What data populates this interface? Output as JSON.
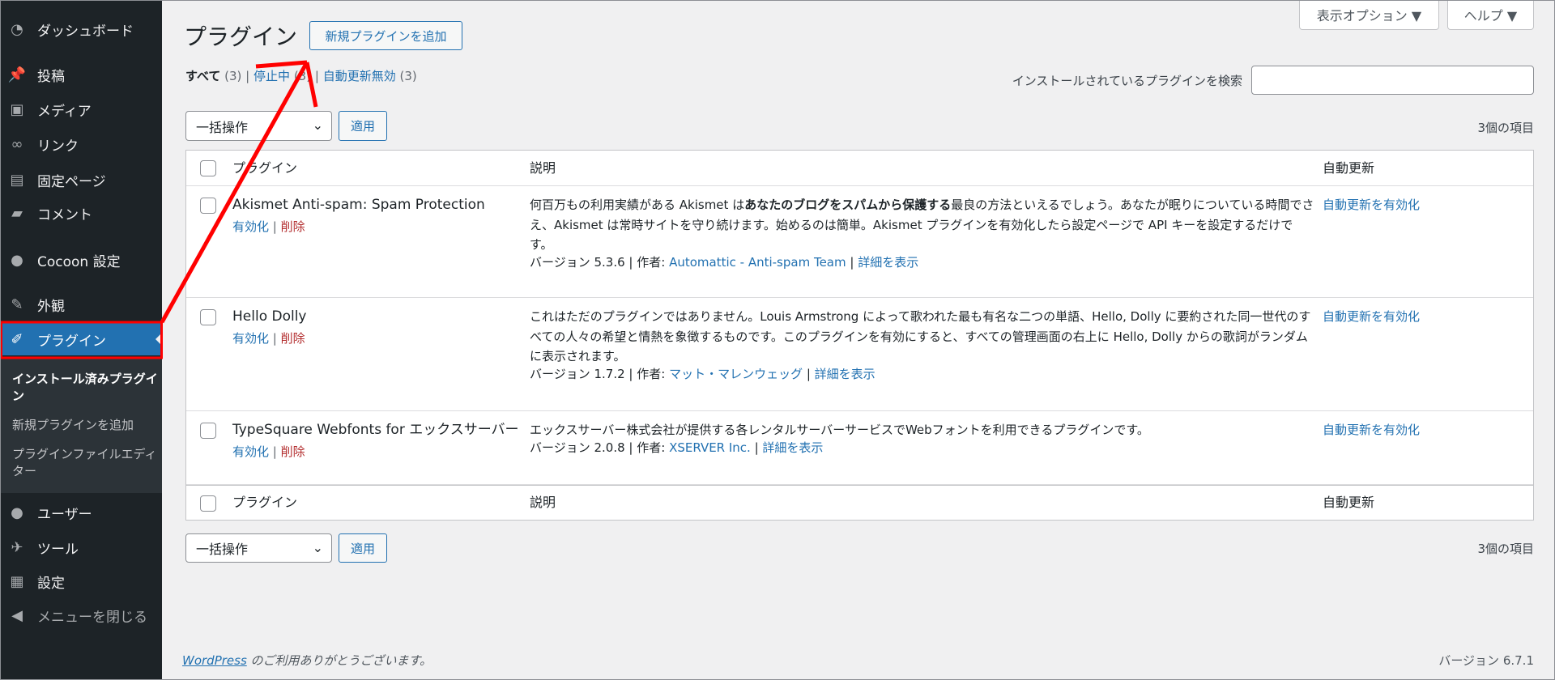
{
  "sidebar": {
    "items": [
      {
        "label": "ダッシュボード",
        "icon": "dashboard-icon"
      },
      {
        "label": "投稿",
        "icon": "pin-icon"
      },
      {
        "label": "メディア",
        "icon": "media-icon"
      },
      {
        "label": "リンク",
        "icon": "link-icon"
      },
      {
        "label": "固定ページ",
        "icon": "page-icon"
      },
      {
        "label": "コメント",
        "icon": "comment-icon"
      },
      {
        "label": "Cocoon 設定",
        "icon": "circle-icon"
      },
      {
        "label": "外観",
        "icon": "brush-icon"
      },
      {
        "label": "プラグイン",
        "icon": "plugin-icon"
      },
      {
        "label": "ユーザー",
        "icon": "user-icon"
      },
      {
        "label": "ツール",
        "icon": "wrench-icon"
      },
      {
        "label": "設定",
        "icon": "settings-icon"
      },
      {
        "label": "メニューを閉じる",
        "icon": "collapse-icon"
      }
    ],
    "submenu": [
      "インストール済みプラグイン",
      "新規プラグインを追加",
      "プラグインファイルエディター"
    ]
  },
  "header": {
    "title": "プラグイン",
    "add_new": "新規プラグインを追加",
    "screen_options": "表示オプション ▼",
    "help": "ヘルプ ▼"
  },
  "filters": [
    {
      "label": "すべて",
      "count": "(3)"
    },
    {
      "label": "停止中",
      "count": "(3)"
    },
    {
      "label": "自動更新無効",
      "count": "(3)"
    }
  ],
  "search": {
    "label": "インストールされているプラグインを検索",
    "value": ""
  },
  "bulk": {
    "select": "一括操作",
    "apply": "適用",
    "count": "3個の項目"
  },
  "table": {
    "columns": [
      "プラグイン",
      "説明",
      "自動更新"
    ],
    "rows": [
      {
        "name": "Akismet Anti-spam: Spam Protection",
        "activate": "有効化",
        "delete": "削除",
        "desc_pre": "何百万もの利用実績がある Akismet は",
        "desc_bold": "あなたのブログをスパムから保護する",
        "desc_post": "最良の方法といえるでしょう。あなたが眠りについている時間でさえ、Akismet は常時サイトを守り続けます。始めるのは簡単。Akismet プラグインを有効化したら設定ページで API キーを設定するだけです。",
        "version": "バージョン 5.3.6 | 作者: ",
        "author": "Automattic - Anti-spam Team",
        "details": "詳細を表示",
        "auto": "自動更新を有効化"
      },
      {
        "name": "Hello Dolly",
        "activate": "有効化",
        "delete": "削除",
        "desc_pre": "これはただのプラグインではありません。Louis Armstrong によって歌われた最も有名な二つの単語、Hello, Dolly に要約された同一世代のすべての人々の希望と情熱を象徴するものです。このプラグインを有効にすると、すべての管理画面の右上に Hello, Dolly からの歌詞がランダムに表示されます。",
        "desc_bold": "",
        "desc_post": "",
        "version": "バージョン 1.7.2 | 作者: ",
        "author": "マット・マレンウェッグ",
        "details": "詳細を表示",
        "auto": "自動更新を有効化"
      },
      {
        "name": "TypeSquare Webfonts for エックスサーバー",
        "activate": "有効化",
        "delete": "削除",
        "desc_pre": "エックスサーバー株式会社が提供する各レンタルサーバーサービスでWebフォントを利用できるプラグインです。",
        "desc_bold": "",
        "desc_post": "",
        "version": "バージョン 2.0.8 | 作者: ",
        "author": "XSERVER Inc.",
        "details": "詳細を表示",
        "auto": "自動更新を有効化"
      }
    ]
  },
  "footer": {
    "link": "WordPress",
    "text": " のご利用ありがとうございます。",
    "version": "バージョン 6.7.1"
  },
  "colors": {
    "accent": "#2271b1",
    "sidebar": "#1d2327",
    "annotation": "#ff0000"
  }
}
